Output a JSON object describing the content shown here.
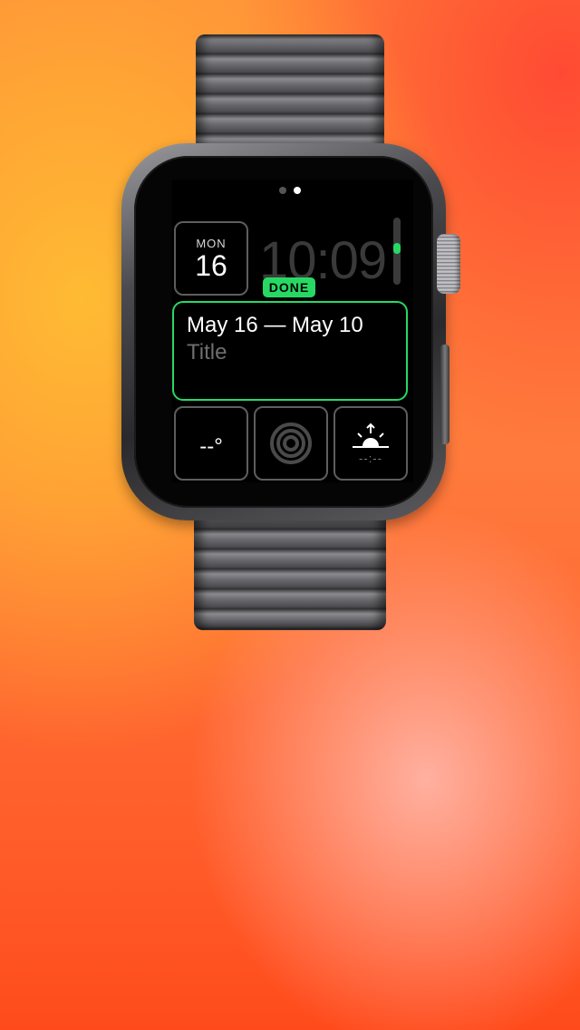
{
  "screen": {
    "page_dots": [
      false,
      true
    ],
    "date": {
      "weekday": "MON",
      "day": "16"
    },
    "time": "10:09",
    "done_label": "DONE",
    "module": {
      "title": "May 16 — May 10",
      "subtitle": "Title"
    },
    "weather": {
      "value": "--°",
      "icon": "weather-icon"
    },
    "activity": {
      "icon": "activity-rings-icon"
    },
    "sunrise": {
      "icon": "sunrise-icon",
      "time": "--:--"
    }
  },
  "colors": {
    "accent_green": "#27d964",
    "screen_background": "#000000",
    "complication_border": "#5e5e5e"
  }
}
